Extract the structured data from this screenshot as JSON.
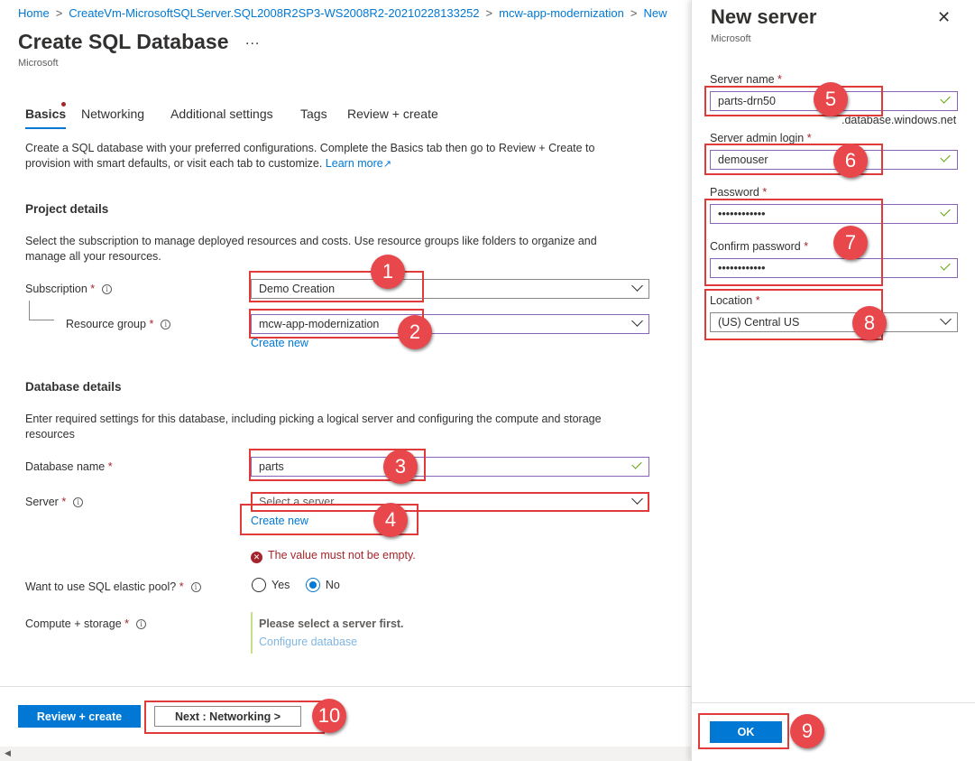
{
  "breadcrumb": {
    "items": [
      "Home",
      "CreateVm-MicrosoftSQLServer.SQL2008R2SP3-WS2008R2-20210228133252",
      "mcw-app-modernization",
      "New"
    ]
  },
  "page": {
    "title": "Create SQL Database",
    "more": "...",
    "subtitle": "Microsoft"
  },
  "tabs": [
    "Basics",
    "Networking",
    "Additional settings",
    "Tags",
    "Review + create"
  ],
  "intro": {
    "text": "Create a SQL database with your preferred configurations. Complete the Basics tab then go to Review + Create to provision with smart defaults, or visit each tab to customize.",
    "learn_more": "Learn more",
    "external_icon": "↗"
  },
  "project": {
    "heading": "Project details",
    "description": "Select the subscription to manage deployed resources and costs. Use resource groups like folders to organize and manage all your resources.",
    "subscription_label": "Subscription",
    "subscription_value": "Demo Creation",
    "resource_group_label": "Resource group",
    "resource_group_value": "mcw-app-modernization",
    "create_new": "Create new"
  },
  "database": {
    "heading": "Database details",
    "description": "Enter required settings for this database, including picking a logical server and configuring the compute and storage resources",
    "name_label": "Database name",
    "name_value": "parts",
    "server_label": "Server",
    "server_placeholder": "Select a server",
    "create_new": "Create new",
    "error": "The value must not be empty.",
    "elastic_label": "Want to use SQL elastic pool?",
    "elastic_yes": "Yes",
    "elastic_no": "No",
    "compute_label": "Compute + storage",
    "compute_notice": "Please select a server first.",
    "configure_link": "Configure database"
  },
  "required_mark": "*",
  "info_icon": "i",
  "footer": {
    "review_create": "Review + create",
    "next": "Next : Networking >"
  },
  "panel": {
    "title": "New server",
    "subtitle": "Microsoft",
    "close_icon": "✕",
    "server_name_label": "Server name",
    "server_name_value": "parts-drn50",
    "domain_suffix": ".database.windows.net",
    "admin_label": "Server admin login",
    "admin_value": "demouser",
    "password_label": "Password",
    "password_value": "••••••••••••",
    "confirm_label": "Confirm password",
    "confirm_value": "••••••••••••",
    "location_label": "Location",
    "location_value": "(US) Central US",
    "ok": "OK"
  },
  "callouts": [
    "1",
    "2",
    "3",
    "4",
    "5",
    "6",
    "7",
    "8",
    "9",
    "10"
  ],
  "colors": {
    "accent": "#0078d4",
    "error": "#a4262c",
    "valid": "#57a300",
    "callout": "#e8474b"
  }
}
